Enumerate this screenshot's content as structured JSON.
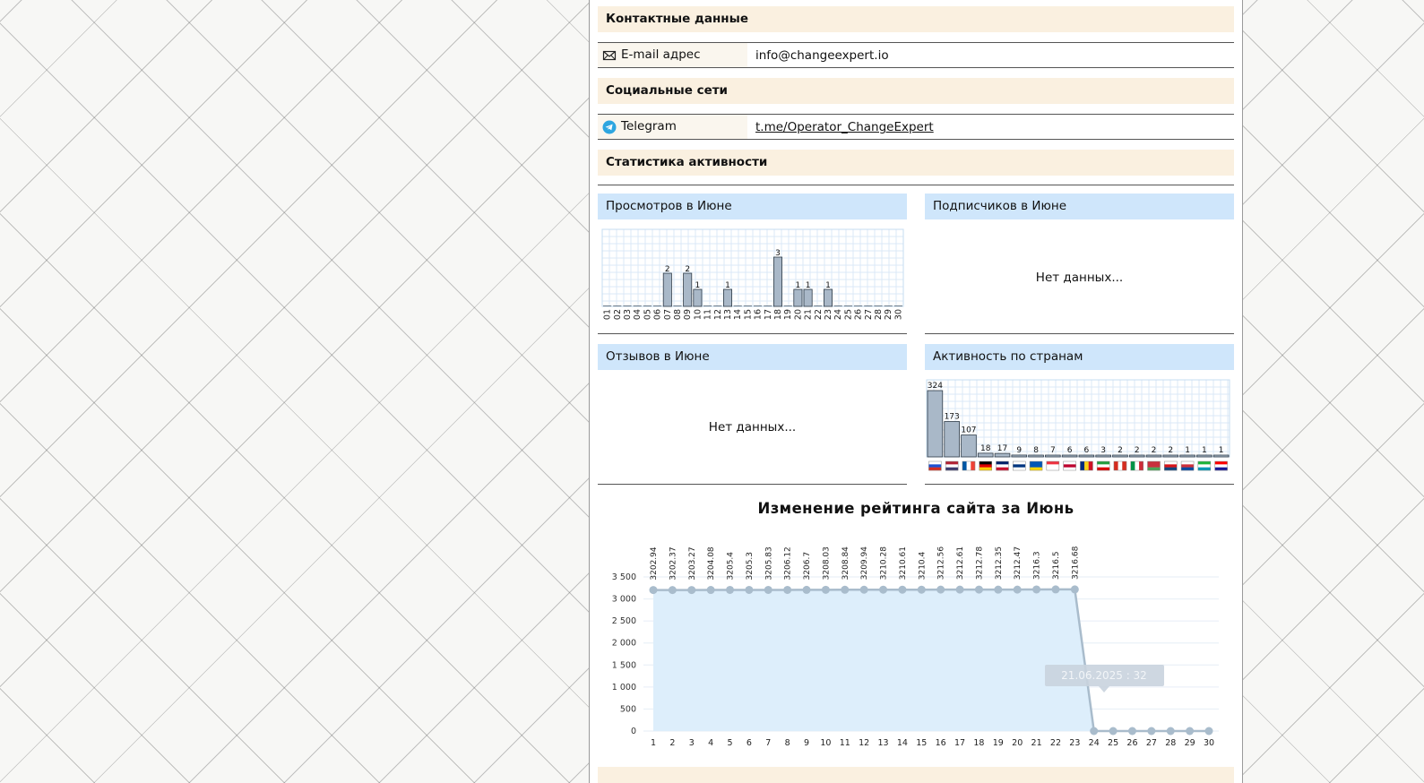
{
  "contacts": {
    "header": "Контактные данные",
    "email_label": "E-mail адрес",
    "email_icon": "envelope-icon",
    "email_value": "info@changeexpert.io"
  },
  "social": {
    "header": "Социальные сети",
    "telegram_label": "Telegram",
    "telegram_icon": "telegram-icon",
    "telegram_value": "t.me/Operator_ChangeExpert"
  },
  "stats": {
    "header": "Статистика активности",
    "views_title": "Просмотров в Июне",
    "subs_title": "Подписчиков в Июне",
    "subs_empty": "Нет данных...",
    "reviews_title": "Отзывов в Июне",
    "reviews_empty": "Нет данных...",
    "countries_title": "Активность по странам"
  },
  "chart_data": [
    {
      "type": "bar",
      "title": "Просмотров в Июне",
      "categories": [
        "01",
        "02",
        "03",
        "04",
        "05",
        "06",
        "07",
        "08",
        "09",
        "10",
        "11",
        "12",
        "13",
        "14",
        "15",
        "16",
        "17",
        "18",
        "19",
        "20",
        "21",
        "22",
        "23",
        "24",
        "25",
        "26",
        "27",
        "28",
        "29",
        "30"
      ],
      "values": [
        0,
        0,
        0,
        0,
        0,
        0,
        2,
        0,
        2,
        1,
        0,
        0,
        1,
        0,
        0,
        0,
        0,
        3,
        0,
        1,
        1,
        0,
        1,
        0,
        0,
        0,
        0,
        0,
        0,
        0
      ],
      "grid": true
    },
    {
      "type": "bar",
      "title": "Активность по странам",
      "categories": [
        "ru",
        "us",
        "fr",
        "de",
        "gb",
        "fi",
        "ua",
        "sg",
        "jp",
        "ro",
        "ir",
        "ca",
        "it",
        "by",
        "cz",
        "kr",
        "uz",
        "hr"
      ],
      "values": [
        324,
        173,
        107,
        18,
        17,
        9,
        8,
        7,
        6,
        6,
        3,
        2,
        2,
        2,
        2,
        1,
        1,
        1
      ],
      "grid": true
    },
    {
      "type": "area",
      "title": "Изменение рейтинга сайта за Июнь",
      "x": [
        1,
        2,
        3,
        4,
        5,
        6,
        7,
        8,
        9,
        10,
        11,
        12,
        13,
        14,
        15,
        16,
        17,
        18,
        19,
        20,
        21,
        22,
        23,
        24,
        25,
        26,
        27,
        28,
        29,
        30
      ],
      "y": [
        3202.94,
        3202.37,
        3203.27,
        3204.08,
        3205.4,
        3205.3,
        3205.83,
        3206.12,
        3206.7,
        3208.03,
        3208.84,
        3209.94,
        3210.28,
        3210.61,
        3210.4,
        3212.56,
        3212.61,
        3212.78,
        3212.35,
        3212.47,
        3216.3,
        3216.5,
        3216.68,
        0,
        0,
        0,
        0,
        0,
        0,
        0
      ],
      "point_labels": [
        "3202.94",
        "3202.37",
        "3203.27",
        "3204.08",
        "3205.4",
        "3205.3",
        "3205.83",
        "3206.12",
        "3206.7",
        "3208.03",
        "3208.84",
        "3209.94",
        "3210.28",
        "3210.61",
        "3210.4",
        "3212.56",
        "3212.61",
        "3212.78",
        "3212.35",
        "3212.47",
        "3216.3",
        "3216.5",
        "3216.68"
      ],
      "y_ticks": [
        "0",
        "500",
        "1 000",
        "1 500",
        "2 000",
        "2 500",
        "3 000",
        "3 500"
      ],
      "ylim": [
        0,
        3500
      ],
      "tooltip": "21.06.2025 : 32",
      "grid": true
    }
  ],
  "colors": {
    "section_bg": "#faf0e0",
    "box_head_bg": "#cfe6fb",
    "bar_fill": "#a9b8c8",
    "line": "#a9bccc",
    "area": "#ddeefb"
  }
}
